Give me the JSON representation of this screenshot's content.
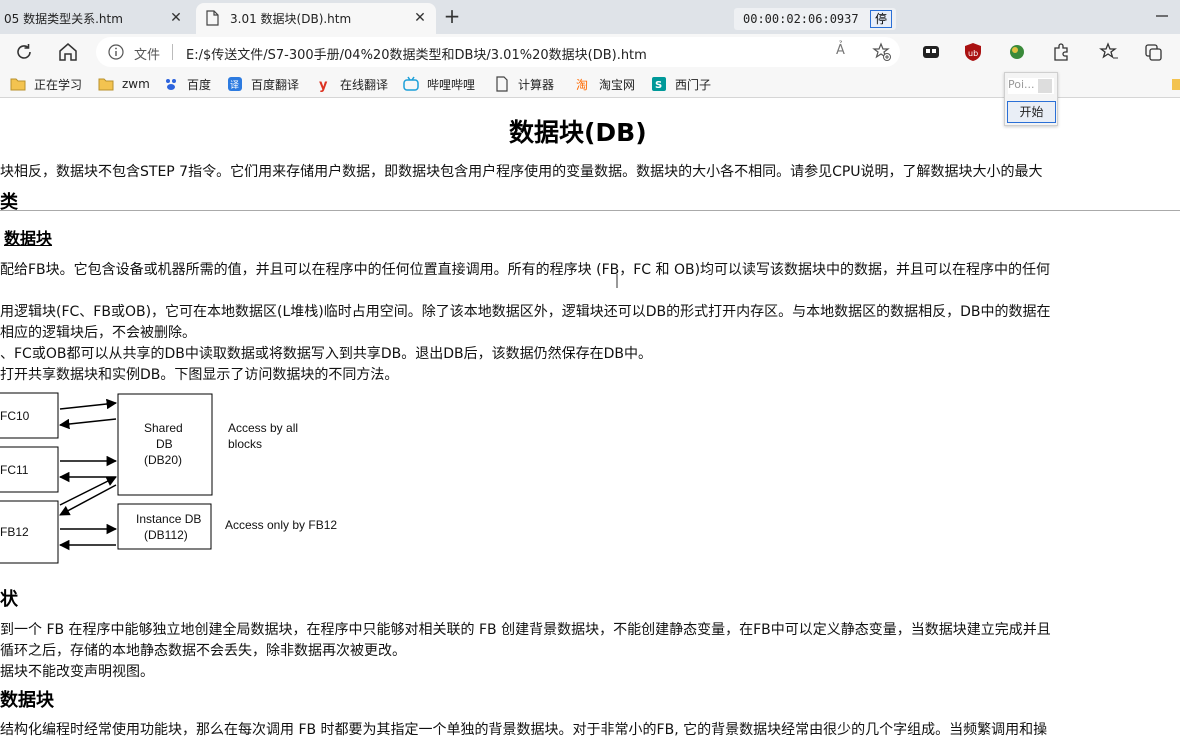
{
  "tabs": [
    {
      "title": "05 数据类型关系.htm",
      "active": false
    },
    {
      "title": "3.01 数据块(DB).htm",
      "active": true
    }
  ],
  "timer": {
    "time": "00:00:02:06:0937",
    "stop_label": "停"
  },
  "address": {
    "scheme_label": "文件",
    "url": "E:/$传送文件/S7-300手册/04%20数据类型和DB块/3.01%20数据块(DB).htm",
    "read_aloud": "Ả"
  },
  "bookmarks": [
    {
      "label": "正在学习",
      "icon": "folder-icon"
    },
    {
      "label": "zwm",
      "icon": "folder-icon"
    },
    {
      "label": "百度",
      "icon": "baidu-icon"
    },
    {
      "label": "百度翻译",
      "icon": "translate-icon"
    },
    {
      "label": "在线翻译",
      "icon": "youdao-icon"
    },
    {
      "label": "哔哩哔哩",
      "icon": "bilibili-icon"
    },
    {
      "label": "计算器",
      "icon": "page-icon"
    },
    {
      "label": "淘宝网",
      "icon": "taobao-icon"
    },
    {
      "label": "西门子",
      "icon": "siemens-icon"
    }
  ],
  "popup": {
    "poi": "Poi...",
    "start": "开始"
  },
  "page": {
    "title": "数据块(DB)",
    "intro": "块相反，数据块不包含STEP 7指令。它们用来存储用户数据，即数据块包含用户程序使用的变量数据。数据块的大小各不相同。请参见CPU说明，了解数据块大小的最大",
    "sec_types": "类",
    "sec_shared": "数据块",
    "p1": "配给FB块。它包含设备或机器所需的值，并且可以在程序中的任何位置直接调用。所有的程序块 (FB，FC 和 OB)均可以读写该数据块中的数据，并且可以在程序中的任何",
    "p2a": "用逻辑块(FC、FB或OB)，它可在本地数据区(L堆栈)临时占用空间。除了该本地数据区外，逻辑块还可以DB的形式打开内存区。与本地数据区的数据相反，DB中的数据在",
    "p2b": "相应的逻辑块后，不会被删除。",
    "p3": "、FC或OB都可以从共享的DB中读取数据或将数据写入到共享DB。退出DB后，该数据仍然保存在DB中。",
    "p4": "打开共享数据块和实例DB。下图显示了访问数据块的不同方法。",
    "sec_note": "状",
    "n1": "到一个 FB 在程序中能够独立地创建全局数据块，在程序中只能够对相关联的 FB 创建背景数据块，不能创建静态变量，在FB中可以定义静态变量，当数据块建立完成并且",
    "n2": "循环之后，存储的本地静态数据不会丢失，除非数据再次被更改。",
    "n3": "据块不能改变声明视图。",
    "sec_instance": "数据块",
    "i1": "结构化编程时经常使用功能块，那么在每次调用 FB 时都要为其指定一个单独的背景数据块。对于非常小的FB, 它的背景数据块经常由很少的几个字组成。当频繁调用和操"
  },
  "diagram": {
    "fc10": "FC10",
    "fc11": "FC11",
    "fb12": "FB12",
    "shared_lines": [
      "Shared",
      "DB",
      "(DB20)"
    ],
    "access_all_lines": [
      "Access by all",
      "blocks"
    ],
    "instance_lines": [
      "Instance DB",
      "(DB112)"
    ],
    "access_fb12": "Access only by FB12"
  }
}
